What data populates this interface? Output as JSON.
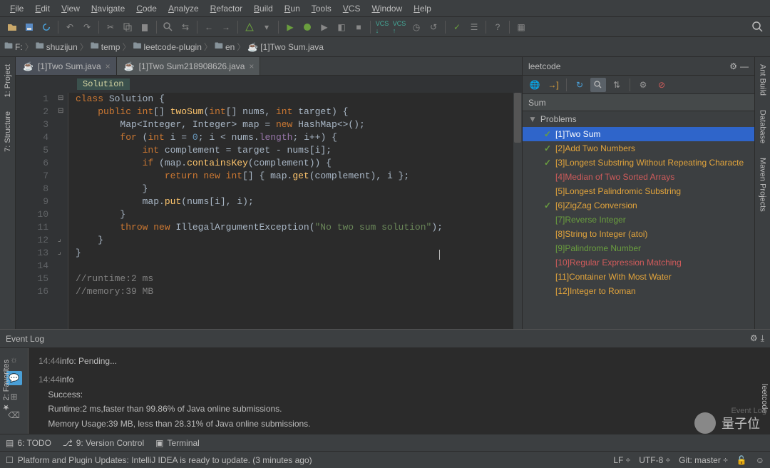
{
  "menu": [
    "File",
    "Edit",
    "View",
    "Navigate",
    "Code",
    "Analyze",
    "Refactor",
    "Build",
    "Run",
    "Tools",
    "VCS",
    "Window",
    "Help"
  ],
  "breadcrumbs": [
    "F:",
    "shuzijun",
    "temp",
    "leetcode-plugin",
    "en",
    "[1]Two Sum.java"
  ],
  "tabs": [
    {
      "label": "[1]Two Sum.java",
      "active": true
    },
    {
      "label": "[1]Two Sum218908626.java",
      "active": false
    }
  ],
  "context_tag": "Solution",
  "code_lines": [
    {
      "n": 1,
      "html": "<span class='k'>class</span> <span class='id'>Solution</span> <span class='p'>{</span>"
    },
    {
      "n": 2,
      "html": "    <span class='k'>public</span> <span class='k'>int</span><span class='p'>[]</span> <span class='fn'>twoSum</span><span class='p'>(</span><span class='k'>int</span><span class='p'>[]</span> <span class='id'>nums</span><span class='p'>,</span> <span class='k'>int</span> <span class='id'>target</span><span class='p'>) {</span>"
    },
    {
      "n": 3,
      "html": "        <span class='id'>Map</span><span class='p'>&lt;</span><span class='id'>Integer</span><span class='p'>,</span> <span class='id'>Integer</span><span class='p'>&gt;</span> <span class='id'>map</span> <span class='p'>=</span> <span class='k'>new</span> <span class='id'>HashMap</span><span class='p'>&lt;&gt;();</span>"
    },
    {
      "n": 4,
      "html": "        <span class='k'>for</span> <span class='p'>(</span><span class='k'>int</span> <span class='id'>i</span> <span class='p'>=</span> <span class='n'>0</span><span class='p'>;</span> <span class='id'>i</span> <span class='p'>&lt;</span> <span class='id'>nums</span><span class='p'>.</span><span class='pk'>length</span><span class='p'>;</span> <span class='id'>i</span><span class='p'>++) {</span>"
    },
    {
      "n": 5,
      "html": "            <span class='k'>int</span> <span class='id'>complement</span> <span class='p'>=</span> <span class='id'>target</span> <span class='p'>-</span> <span class='id'>nums</span><span class='p'>[</span><span class='id'>i</span><span class='p'>];</span>"
    },
    {
      "n": 6,
      "html": "            <span class='k'>if</span> <span class='p'>(</span><span class='id'>map</span><span class='p'>.</span><span class='fn'>containsKey</span><span class='p'>(</span><span class='id'>complement</span><span class='p'>)) {</span>"
    },
    {
      "n": 7,
      "html": "                <span class='k'>return new</span> <span class='k'>int</span><span class='p'>[] {</span> <span class='id'>map</span><span class='p'>.</span><span class='fn'>get</span><span class='p'>(</span><span class='id'>complement</span><span class='p'>),</span> <span class='id'>i</span> <span class='p'>};</span>"
    },
    {
      "n": 8,
      "html": "            <span class='p'>}</span>"
    },
    {
      "n": 9,
      "html": "            <span class='id'>map</span><span class='p'>.</span><span class='fn'>put</span><span class='p'>(</span><span class='id'>nums</span><span class='p'>[</span><span class='id'>i</span><span class='p'>],</span> <span class='id'>i</span><span class='p'>);</span>"
    },
    {
      "n": 10,
      "html": "        <span class='p'>}</span>"
    },
    {
      "n": 11,
      "html": "        <span class='k'>throw new</span> <span class='id'>IllegalArgumentException</span><span class='p'>(</span><span class='s'>\"No two sum solution\"</span><span class='p'>);</span>"
    },
    {
      "n": 12,
      "html": "    <span class='p'>}</span>"
    },
    {
      "n": 13,
      "html": "<span class='p'>}</span>"
    },
    {
      "n": 14,
      "html": ""
    },
    {
      "n": 15,
      "html": "<span class='c'>//runtime:2 ms</span>"
    },
    {
      "n": 16,
      "html": "<span class='c'>//memory:39 MB</span>"
    }
  ],
  "leetcode": {
    "title": "leetcode",
    "search_placeholder": "Sum",
    "root": "Problems",
    "items": [
      {
        "check": true,
        "label": "[1]Two Sum",
        "diff": "easy",
        "selected": true
      },
      {
        "check": true,
        "label": "[2]Add Two Numbers",
        "diff": "medium"
      },
      {
        "check": true,
        "label": "[3]Longest Substring Without Repeating Characte",
        "diff": "medium"
      },
      {
        "check": false,
        "label": "[4]Median of Two Sorted Arrays",
        "diff": "hard"
      },
      {
        "check": false,
        "label": "[5]Longest Palindromic Substring",
        "diff": "medium"
      },
      {
        "check": true,
        "label": "[6]ZigZag Conversion",
        "diff": "medium"
      },
      {
        "check": false,
        "label": "[7]Reverse Integer",
        "diff": "easy"
      },
      {
        "check": false,
        "label": "[8]String to Integer (atoi)",
        "diff": "medium"
      },
      {
        "check": false,
        "label": "[9]Palindrome Number",
        "diff": "easy"
      },
      {
        "check": false,
        "label": "[10]Regular Expression Matching",
        "diff": "hard"
      },
      {
        "check": false,
        "label": "[11]Container With Most Water",
        "diff": "medium"
      },
      {
        "check": false,
        "label": "[12]Integer to Roman",
        "diff": "medium"
      }
    ]
  },
  "event_log": {
    "title": "Event Log",
    "entries": [
      {
        "time": "14:44",
        "text": "info: Pending..."
      },
      {
        "time": "14:44",
        "text": "info",
        "body": [
          "Success:",
          "Runtime:2 ms,faster than 99.86% of Java online submissions.",
          "Memory Usage:39 MB, less than 28.31% of Java online submissions."
        ]
      }
    ]
  },
  "bottom_tools": {
    "todo": "6: TODO",
    "vc": "9: Version Control",
    "terminal": "Terminal"
  },
  "status": {
    "msg": "Platform and Plugin Updates: IntelliJ IDEA is ready to update. (3 minutes ago)",
    "lf": "LF",
    "enc": "UTF-8",
    "git": "Git: master"
  },
  "left_tabs": [
    "1: Project",
    "7: Structure"
  ],
  "right_tabs": [
    "Ant Build",
    "Database",
    "Maven Projects"
  ],
  "fav_label": "2: Favorites",
  "right_bottom": "leetcode",
  "el_side": "Event Log",
  "watermark": "量子位"
}
